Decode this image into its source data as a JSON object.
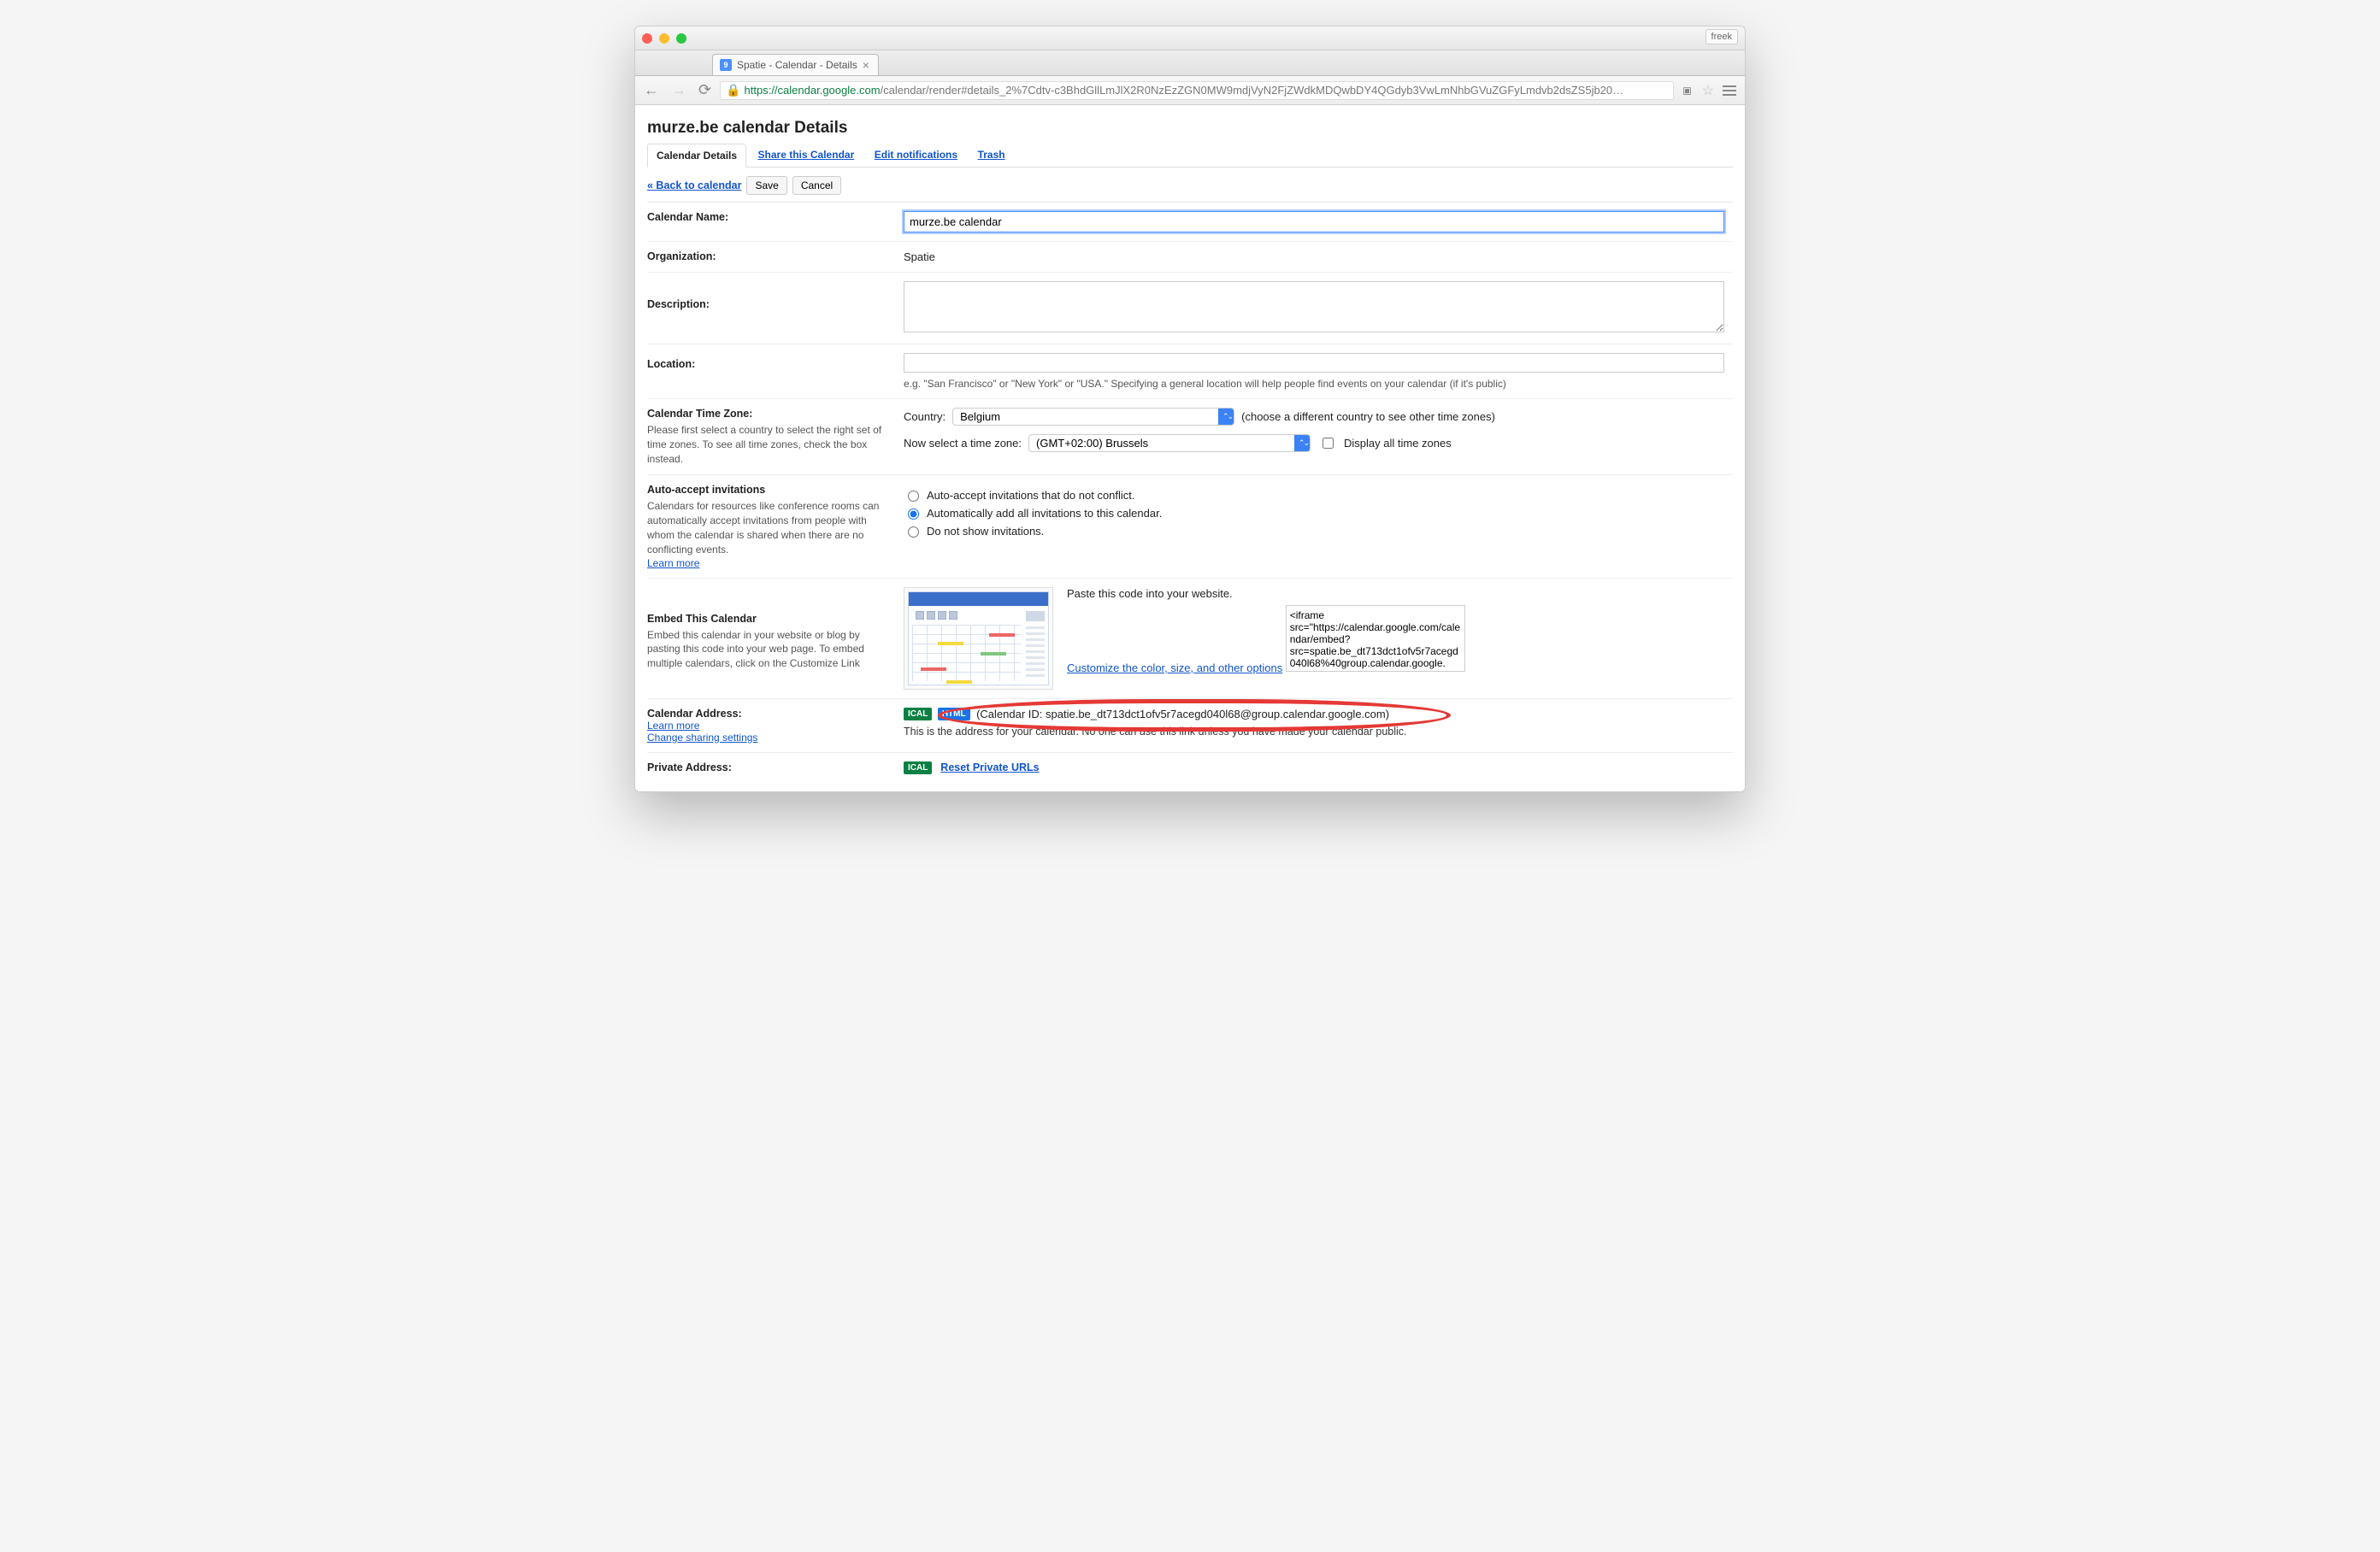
{
  "chrome": {
    "profile": "freek",
    "tab_title": "Spatie - Calendar - Details",
    "favicon_char": "9",
    "url_green": "https",
    "url_host": "://calendar.google.com",
    "url_path": "/calendar/render#details_2%7Cdtv-c3BhdGllLmJlX2R0NzEzZGN0MW9mdjVyN2FjZWdkMDQwbDY4QGdyb3VwLmNhbGVuZGFyLmdvb2dsZS5jb20"
  },
  "page": {
    "title": "murze.be calendar Details",
    "tabs": {
      "details": "Calendar Details",
      "share": "Share this Calendar",
      "notifications": "Edit notifications",
      "trash": "Trash"
    },
    "back": "« Back to calendar",
    "save": "Save",
    "cancel": "Cancel"
  },
  "fields": {
    "name": {
      "label": "Calendar Name:",
      "value": "murze.be calendar"
    },
    "org": {
      "label": "Organization:",
      "value": "Spatie"
    },
    "desc": {
      "label": "Description:",
      "value": ""
    },
    "location": {
      "label": "Location:",
      "value": "",
      "hint": "e.g. \"San Francisco\" or \"New York\" or \"USA.\" Specifying a general location will help people find events on your calendar (if it's public)"
    },
    "timezone": {
      "label": "Calendar Time Zone:",
      "sub": "Please first select a country to select the right set of time zones. To see all time zones, check the box instead.",
      "country_label": "Country:",
      "country_value": "Belgium",
      "country_hint": "(choose a different country to see other time zones)",
      "tz_label": "Now select a time zone:",
      "tz_value": "(GMT+02:00) Brussels",
      "display_all": "Display all time zones"
    },
    "autoaccept": {
      "label": "Auto-accept invitations",
      "sub": "Calendars for resources like conference rooms can automatically accept invitations from people with whom the calendar is shared when there are no conflicting events.",
      "learn": "Learn more",
      "opt1": "Auto-accept invitations that do not conflict.",
      "opt2": "Automatically add all invitations to this calendar.",
      "opt3": "Do not show invitations."
    },
    "embed": {
      "label": "Embed This Calendar",
      "sub": "Embed this calendar in your website or blog by pasting this code into your web page. To embed multiple calendars, click on the Customize Link",
      "paste": "Paste this code into your website.",
      "customize": "Customize the color, size, and other options",
      "code": "<iframe src=\"https://calendar.google.com/calendar/embed?src=spatie.be_dt713dct1ofv5r7acegd040l68%40group.calendar.google."
    },
    "address": {
      "label": "Calendar Address:",
      "learn": "Learn more",
      "change": "Change sharing settings",
      "ical": "ICAL",
      "html": "HTML",
      "cal_id": "(Calendar ID: spatie.be_dt713dct1ofv5r7acegd040l68@group.calendar.google.com)",
      "desc": "This is the address for your calendar. No one can use this link unless you have made your calendar public."
    },
    "private": {
      "label": "Private Address:",
      "ical": "ICAL",
      "reset": "Reset Private URLs"
    }
  }
}
